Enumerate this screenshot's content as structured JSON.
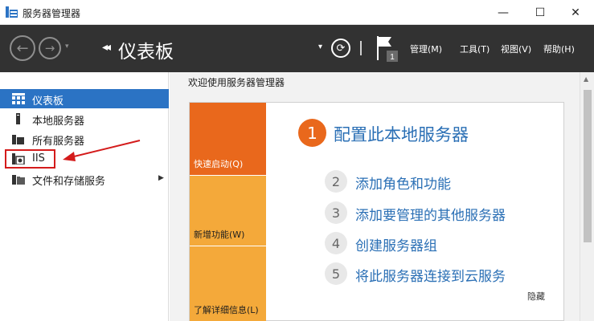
{
  "window": {
    "title": "服务器管理器",
    "icon": "server-manager-icon",
    "controls": {
      "minimize": "—",
      "maximize": "☐",
      "close": "✕"
    }
  },
  "toolbar": {
    "back_glyph": "←",
    "forward_glyph": "→",
    "dropdown_glyph": "▾",
    "breadcrumb_arrows": "◂◂",
    "page_title": "仪表板",
    "refresh_glyph": "⟳",
    "flag_badge": "1",
    "menus": [
      {
        "label": "管理(M)"
      },
      {
        "label": "工具(T)"
      },
      {
        "label": "视图(V)"
      },
      {
        "label": "帮助(H)"
      }
    ]
  },
  "sidebar": {
    "items": [
      {
        "label": "仪表板",
        "icon": "dashboard-icon",
        "active": true
      },
      {
        "label": "本地服务器",
        "icon": "local-server-icon"
      },
      {
        "label": "所有服务器",
        "icon": "all-servers-icon"
      },
      {
        "label": "IIS",
        "icon": "iis-icon"
      },
      {
        "label": "文件和存储服务",
        "icon": "file-storage-icon",
        "has_submenu": true
      }
    ],
    "chevron": "▶"
  },
  "main": {
    "welcome_title": "欢迎使用服务器管理器",
    "tiles": [
      {
        "label": "快速启动(Q)",
        "color": "#e9681c"
      },
      {
        "label": "新增功能(W)",
        "color": "#f4a93a"
      },
      {
        "label": "了解详细信息(L)",
        "color": "#f4a93a"
      }
    ],
    "steps": [
      {
        "num": "1",
        "label": "配置此本地服务器"
      },
      {
        "num": "2",
        "label": "添加角色和功能"
      },
      {
        "num": "3",
        "label": "添加要管理的其他服务器"
      },
      {
        "num": "4",
        "label": "创建服务器组"
      },
      {
        "num": "5",
        "label": "将此服务器连接到云服务"
      }
    ],
    "hide_label": "隐藏"
  },
  "colors": {
    "toolbar_bg": "#323232",
    "active_item": "#2b73c4",
    "accent_orange": "#e9681c",
    "tile_amber": "#f4a93a",
    "link_blue": "#2a6fb5",
    "annotation_red": "#d41b1b"
  }
}
